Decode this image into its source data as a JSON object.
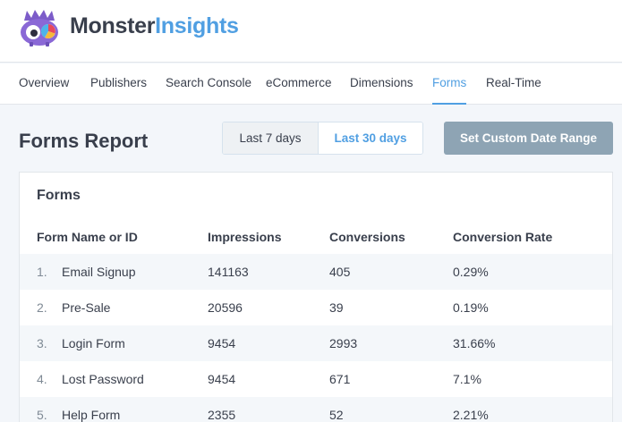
{
  "brand": {
    "part1": "Monster",
    "part2": "Insights"
  },
  "nav": {
    "tabs": [
      {
        "label": "Overview"
      },
      {
        "label": "Publishers"
      },
      {
        "label": "Search Console"
      },
      {
        "label": "eCommerce"
      },
      {
        "label": "Dimensions"
      },
      {
        "label": "Forms",
        "active": true
      },
      {
        "label": "Real-Time"
      }
    ]
  },
  "report": {
    "title": "Forms Report",
    "ranges": {
      "last7": "Last 7 days",
      "last30": "Last 30 days",
      "selected": "Last 30 days"
    },
    "custom_range_label": "Set Custom Date Range"
  },
  "panel": {
    "title": "Forms",
    "columns": [
      "Form Name or ID",
      "Impressions",
      "Conversions",
      "Conversion Rate"
    ],
    "rows": [
      {
        "num": "1.",
        "name": "Email Signup",
        "impressions": "141163",
        "conversions": "405",
        "rate": "0.29%"
      },
      {
        "num": "2.",
        "name": "Pre-Sale",
        "impressions": "20596",
        "conversions": "39",
        "rate": "0.19%"
      },
      {
        "num": "3.",
        "name": "Login Form",
        "impressions": "9454",
        "conversions": "2993",
        "rate": "31.66%"
      },
      {
        "num": "4.",
        "name": "Lost Password",
        "impressions": "9454",
        "conversions": "671",
        "rate": "7.1%"
      },
      {
        "num": "5.",
        "name": "Help Form",
        "impressions": "2355",
        "conversions": "52",
        "rate": "2.21%"
      }
    ]
  },
  "colors": {
    "accent": "#509fe2",
    "button": "#8ea4b4",
    "text": "#393f4c",
    "logo": "#7c5cc9"
  },
  "icons": {
    "logo": "monster-logo-icon"
  }
}
